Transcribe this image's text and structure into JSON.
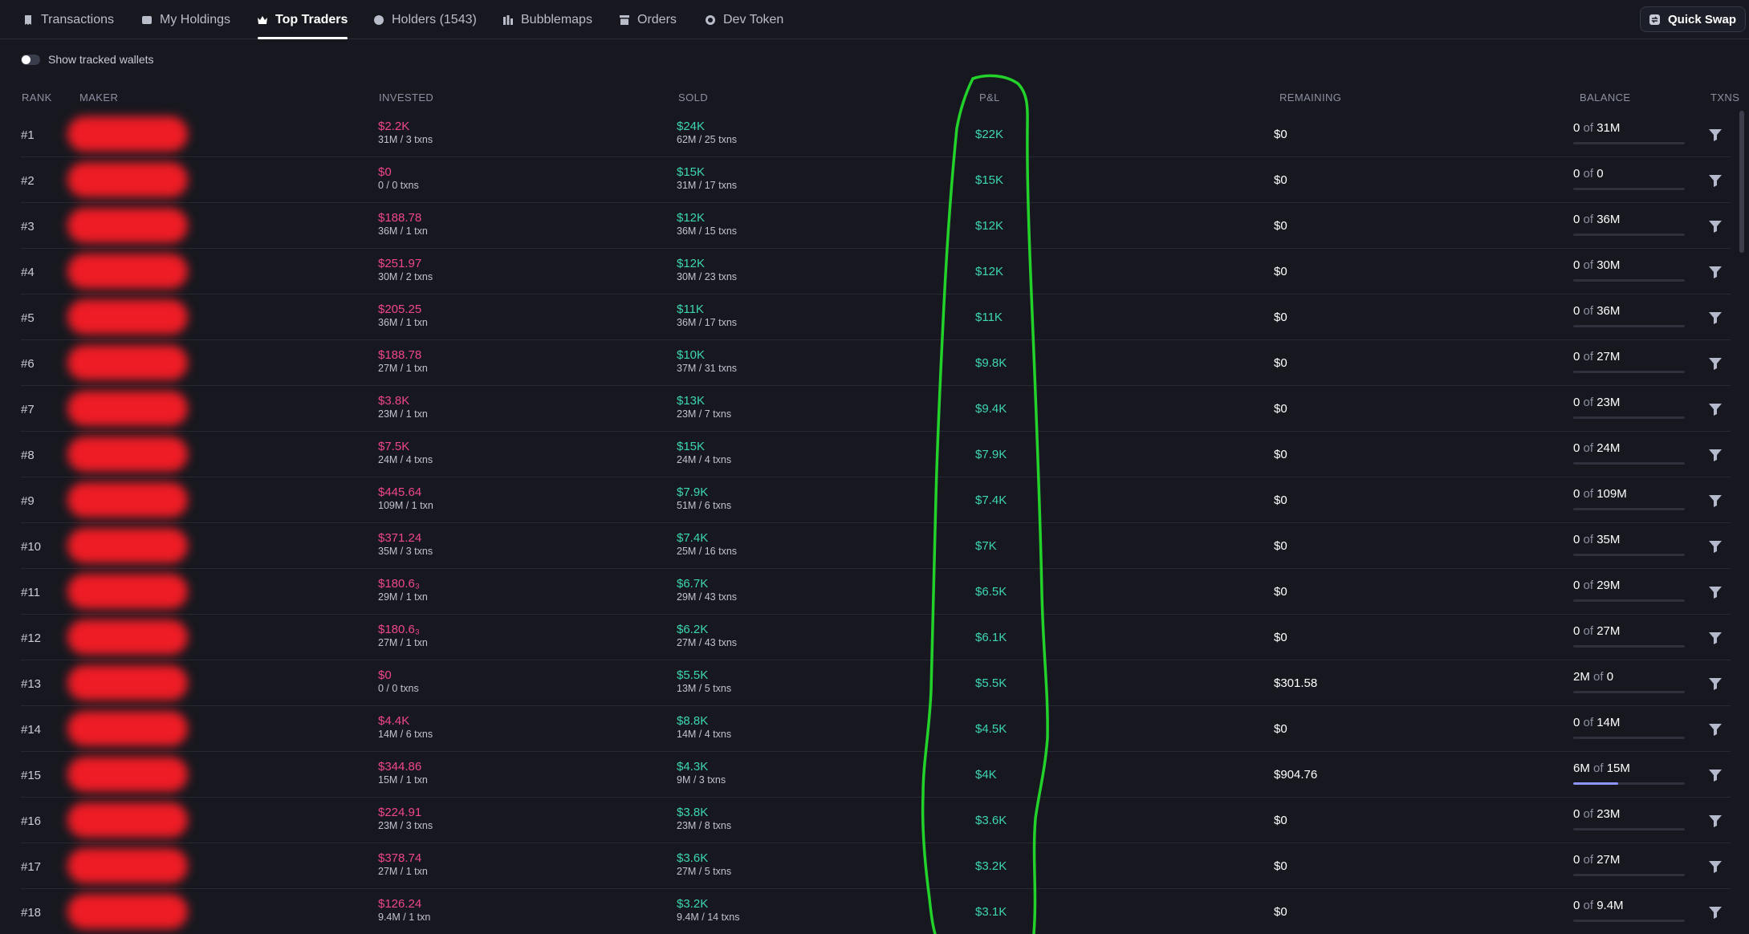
{
  "tabs": [
    {
      "label": "Transactions",
      "icon": "receipt-icon",
      "active": false
    },
    {
      "label": "My Holdings",
      "icon": "wallet-icon",
      "active": false
    },
    {
      "label": "Top Traders",
      "icon": "crown-icon",
      "active": true
    },
    {
      "label": "Holders (1543)",
      "icon": "user-circle-icon",
      "active": false
    },
    {
      "label": "Bubblemaps",
      "icon": "bubblemap-icon",
      "active": false
    },
    {
      "label": "Orders",
      "icon": "orders-icon",
      "active": false
    },
    {
      "label": "Dev Token",
      "icon": "dev-token-icon",
      "active": false
    }
  ],
  "quick_swap_label": "Quick Swap",
  "toggle_label": "Show tracked wallets",
  "columns": {
    "rank": "RANK",
    "maker": "MAKER",
    "invested": "INVESTED",
    "sold": "SOLD",
    "pnl": "P&L",
    "remaining": "REMAINING",
    "balance": "BALANCE",
    "txns": "TXNS"
  },
  "colors": {
    "background": "#17181f",
    "invested": "#f0468a",
    "profit": "#3dd6b2",
    "annotation": "#22d12a",
    "redaction": "#ee1c25",
    "balance_bar": "#8f95ff"
  },
  "rows": [
    {
      "rank": "#1",
      "invested": "$2.2K",
      "invested_sub": "31M / 3 txns",
      "sold": "$24K",
      "sold_sub": "62M / 25 txns",
      "pnl": "$22K",
      "remaining": "$0",
      "bal_amount": "0",
      "bal_of": "of",
      "bal_total": "31M",
      "bal_fraction": 0
    },
    {
      "rank": "#2",
      "invested": "$0",
      "invested_sub": "0 / 0 txns",
      "sold": "$15K",
      "sold_sub": "31M / 17 txns",
      "pnl": "$15K",
      "remaining": "$0",
      "bal_amount": "0",
      "bal_of": "of",
      "bal_total": "0",
      "bal_fraction": 0
    },
    {
      "rank": "#3",
      "invested": "$188.78",
      "invested_sub": "36M / 1 txn",
      "sold": "$12K",
      "sold_sub": "36M / 15 txns",
      "pnl": "$12K",
      "remaining": "$0",
      "bal_amount": "0",
      "bal_of": "of",
      "bal_total": "36M",
      "bal_fraction": 0
    },
    {
      "rank": "#4",
      "invested": "$251.97",
      "invested_sub": "30M / 2 txns",
      "sold": "$12K",
      "sold_sub": "30M / 23 txns",
      "pnl": "$12K",
      "remaining": "$0",
      "bal_amount": "0",
      "bal_of": "of",
      "bal_total": "30M",
      "bal_fraction": 0
    },
    {
      "rank": "#5",
      "invested": "$205.25",
      "invested_sub": "36M / 1 txn",
      "sold": "$11K",
      "sold_sub": "36M / 17 txns",
      "pnl": "$11K",
      "remaining": "$0",
      "bal_amount": "0",
      "bal_of": "of",
      "bal_total": "36M",
      "bal_fraction": 0
    },
    {
      "rank": "#6",
      "invested": "$188.78",
      "invested_sub": "27M / 1 txn",
      "sold": "$10K",
      "sold_sub": "37M / 31 txns",
      "pnl": "$9.8K",
      "remaining": "$0",
      "bal_amount": "0",
      "bal_of": "of",
      "bal_total": "27M",
      "bal_fraction": 0
    },
    {
      "rank": "#7",
      "invested": "$3.8K",
      "invested_sub": "23M / 1 txn",
      "sold": "$13K",
      "sold_sub": "23M / 7 txns",
      "pnl": "$9.4K",
      "remaining": "$0",
      "bal_amount": "0",
      "bal_of": "of",
      "bal_total": "23M",
      "bal_fraction": 0
    },
    {
      "rank": "#8",
      "invested": "$7.5K",
      "invested_sub": "24M / 4 txns",
      "sold": "$15K",
      "sold_sub": "24M / 4 txns",
      "pnl": "$7.9K",
      "remaining": "$0",
      "bal_amount": "0",
      "bal_of": "of",
      "bal_total": "24M",
      "bal_fraction": 0
    },
    {
      "rank": "#9",
      "invested": "$445.64",
      "invested_sub": "109M / 1 txn",
      "sold": "$7.9K",
      "sold_sub": "51M / 6 txns",
      "pnl": "$7.4K",
      "remaining": "$0",
      "bal_amount": "0",
      "bal_of": "of",
      "bal_total": "109M",
      "bal_fraction": 0
    },
    {
      "rank": "#10",
      "invested": "$371.24",
      "invested_sub": "35M / 3 txns",
      "sold": "$7.4K",
      "sold_sub": "25M / 16 txns",
      "pnl": "$7K",
      "remaining": "$0",
      "bal_amount": "0",
      "bal_of": "of",
      "bal_total": "35M",
      "bal_fraction": 0
    },
    {
      "rank": "#11",
      "invested": "$180.6₃",
      "invested_sub": "29M / 1 txn",
      "sold": "$6.7K",
      "sold_sub": "29M / 43 txns",
      "pnl": "$6.5K",
      "remaining": "$0",
      "bal_amount": "0",
      "bal_of": "of",
      "bal_total": "29M",
      "bal_fraction": 0
    },
    {
      "rank": "#12",
      "invested": "$180.6₃",
      "invested_sub": "27M / 1 txn",
      "sold": "$6.2K",
      "sold_sub": "27M / 43 txns",
      "pnl": "$6.1K",
      "remaining": "$0",
      "bal_amount": "0",
      "bal_of": "of",
      "bal_total": "27M",
      "bal_fraction": 0
    },
    {
      "rank": "#13",
      "invested": "$0",
      "invested_sub": "0 / 0 txns",
      "sold": "$5.5K",
      "sold_sub": "13M / 5 txns",
      "pnl": "$5.5K",
      "remaining": "$301.58",
      "bal_amount": "2M",
      "bal_of": "of",
      "bal_total": "0",
      "bal_fraction": 0
    },
    {
      "rank": "#14",
      "invested": "$4.4K",
      "invested_sub": "14M / 6 txns",
      "sold": "$8.8K",
      "sold_sub": "14M / 4 txns",
      "pnl": "$4.5K",
      "remaining": "$0",
      "bal_amount": "0",
      "bal_of": "of",
      "bal_total": "14M",
      "bal_fraction": 0
    },
    {
      "rank": "#15",
      "invested": "$344.86",
      "invested_sub": "15M / 1 txn",
      "sold": "$4.3K",
      "sold_sub": "9M / 3 txns",
      "pnl": "$4K",
      "remaining": "$904.76",
      "bal_amount": "6M",
      "bal_of": "of",
      "bal_total": "15M",
      "bal_fraction": 0.4
    },
    {
      "rank": "#16",
      "invested": "$224.91",
      "invested_sub": "23M / 3 txns",
      "sold": "$3.8K",
      "sold_sub": "23M / 8 txns",
      "pnl": "$3.6K",
      "remaining": "$0",
      "bal_amount": "0",
      "bal_of": "of",
      "bal_total": "23M",
      "bal_fraction": 0
    },
    {
      "rank": "#17",
      "invested": "$378.74",
      "invested_sub": "27M / 1 txn",
      "sold": "$3.6K",
      "sold_sub": "27M / 5 txns",
      "pnl": "$3.2K",
      "remaining": "$0",
      "bal_amount": "0",
      "bal_of": "of",
      "bal_total": "27M",
      "bal_fraction": 0
    },
    {
      "rank": "#18",
      "invested": "$126.24",
      "invested_sub": "9.4M / 1 txn",
      "sold": "$3.2K",
      "sold_sub": "9.4M / 14 txns",
      "pnl": "$3.1K",
      "remaining": "$0",
      "bal_amount": "0",
      "bal_of": "of",
      "bal_total": "9.4M",
      "bal_fraction": 0
    }
  ]
}
